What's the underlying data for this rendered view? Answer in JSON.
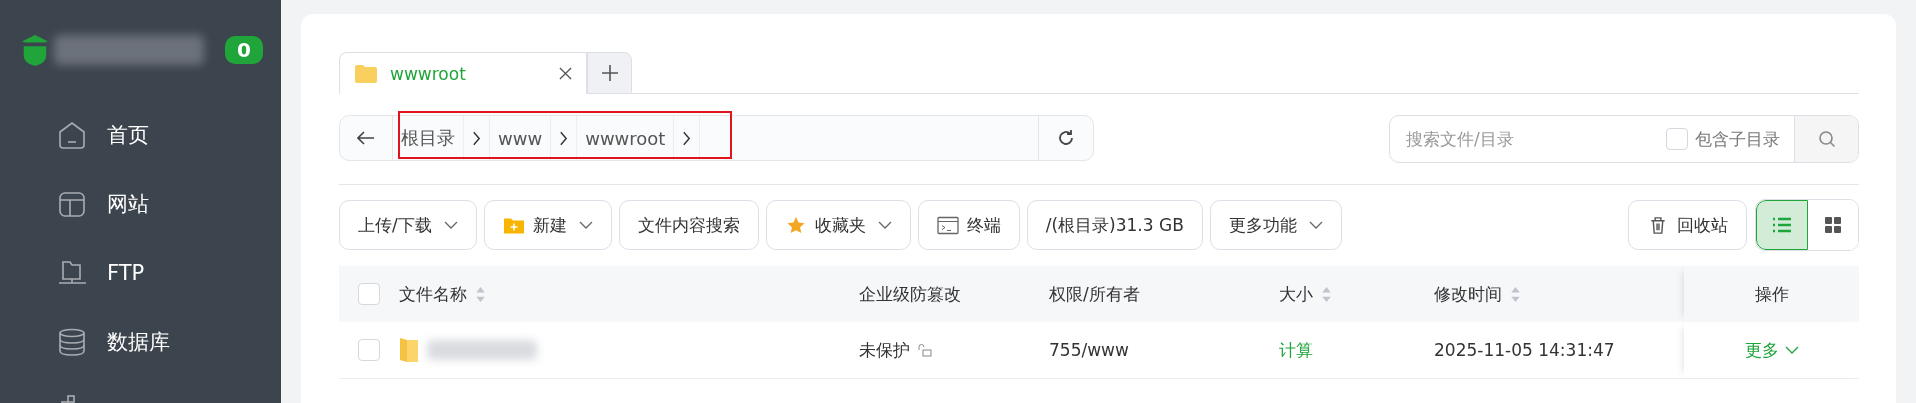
{
  "sidebar": {
    "badge": "0",
    "items": [
      {
        "label": "首页",
        "kind": "home"
      },
      {
        "label": "网站",
        "kind": "site"
      },
      {
        "label": "FTP",
        "kind": "ftp"
      },
      {
        "label": "数据库",
        "kind": "db"
      },
      {
        "kind": "docker"
      }
    ]
  },
  "tabs": [
    {
      "label": "wwwroot",
      "selected": true
    }
  ],
  "breadcrumb": [
    "根目录",
    "www",
    "wwwroot"
  ],
  "search": {
    "placeholder": "搜索文件/目录",
    "subdir": {
      "label": "包含子目录",
      "checked": false
    }
  },
  "toolbar": [
    {
      "label": "上传/下载",
      "kind": "plain",
      "dropdown": true
    },
    {
      "label": "新建",
      "kind": "create",
      "dropdown": true
    },
    {
      "label": "文件内容搜索",
      "kind": "plain",
      "dropdown": false
    },
    {
      "label": "收藏夹",
      "kind": "favorites",
      "dropdown": true
    },
    {
      "label": "终端",
      "kind": "terminal",
      "dropdown": false
    },
    {
      "label": "/(根目录)31.3 GB",
      "kind": "plain",
      "dropdown": false
    },
    {
      "label": "更多功能",
      "kind": "plain",
      "dropdown": true
    }
  ],
  "recycle": "回收站",
  "views": [
    {
      "kind": "list",
      "selected": true
    },
    {
      "kind": "grid",
      "selected": false
    }
  ],
  "table": {
    "all_checked": false,
    "columns": [
      {
        "label": "文件名称",
        "sortable": true
      },
      {
        "label": "企业级防篡改",
        "sortable": false
      },
      {
        "label": "权限/所有者",
        "sortable": false
      },
      {
        "label": "大小",
        "sortable": true
      },
      {
        "label": "修改时间",
        "sortable": true
      },
      {
        "label": "操作",
        "sortable": false
      }
    ],
    "rows": [
      {
        "checked": false,
        "protection": "未保护",
        "permission": "755/www",
        "size": "计算",
        "modified": "2025-11-05 14:31:47",
        "action": "更多"
      }
    ]
  }
}
